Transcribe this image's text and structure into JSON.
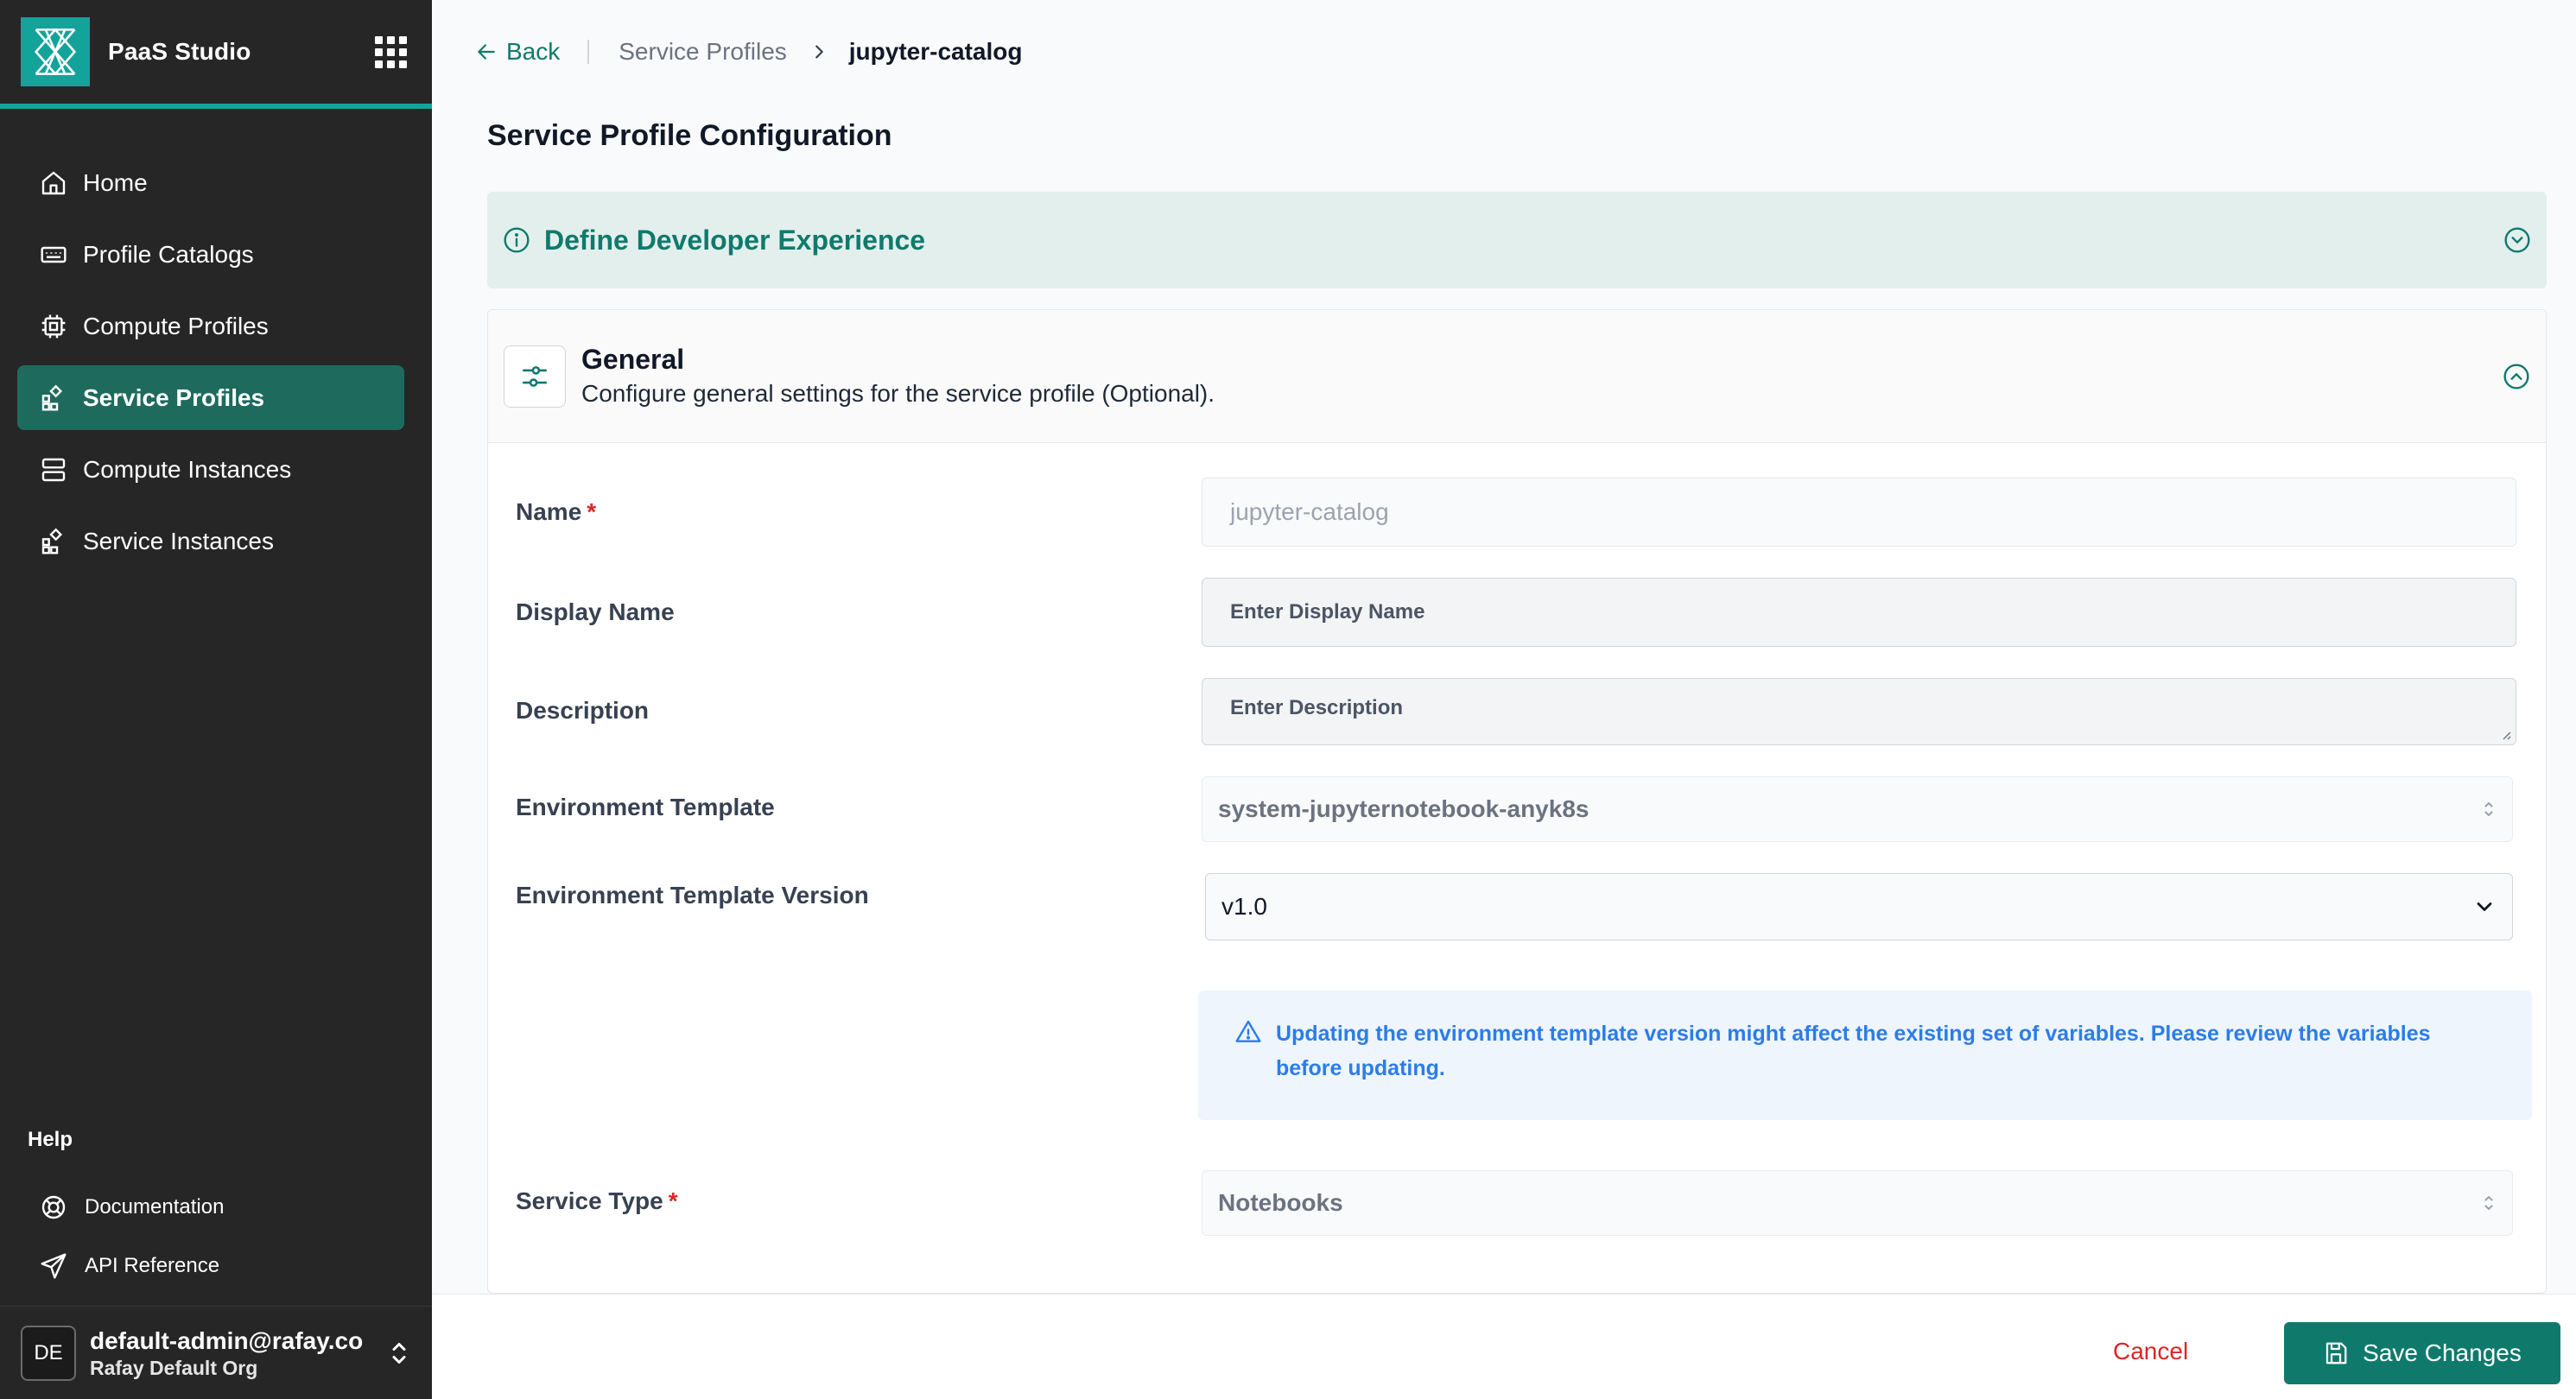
{
  "app": {
    "name": "PaaS Studio",
    "brand_color": "#14a39a"
  },
  "sidebar": {
    "items": [
      {
        "label": "Home",
        "icon": "home-icon",
        "active": false
      },
      {
        "label": "Profile Catalogs",
        "icon": "catalog-icon",
        "active": false
      },
      {
        "label": "Compute Profiles",
        "icon": "chip-icon",
        "active": false
      },
      {
        "label": "Service Profiles",
        "icon": "widgets-icon",
        "active": true
      },
      {
        "label": "Compute Instances",
        "icon": "server-icon",
        "active": false
      },
      {
        "label": "Service Instances",
        "icon": "widgets-icon",
        "active": false
      }
    ],
    "help": {
      "title": "Help",
      "items": [
        {
          "label": "Documentation",
          "icon": "lifebuoy-icon"
        },
        {
          "label": "API Reference",
          "icon": "send-icon"
        }
      ]
    },
    "user": {
      "initials": "DE",
      "email": "default-admin@rafay.co",
      "org": "Rafay Default Org"
    }
  },
  "breadcrumb": {
    "back": "Back",
    "parent": "Service Profiles",
    "current": "jupyter-catalog"
  },
  "page": {
    "title": "Service Profile Configuration"
  },
  "dev_experience": {
    "label": "Define Developer Experience"
  },
  "general": {
    "title": "General",
    "subtitle": "Configure general settings for the service profile (Optional).",
    "fields": {
      "name": {
        "label": "Name",
        "required": "*",
        "value": "jupyter-catalog"
      },
      "display_name": {
        "label": "Display Name",
        "placeholder": "Enter Display Name"
      },
      "description": {
        "label": "Description",
        "placeholder": "Enter Description"
      },
      "env_template": {
        "label": "Environment Template",
        "value": "system-jupyternotebook-anyk8s"
      },
      "env_template_version": {
        "label": "Environment Template Version",
        "value": "v1.0"
      },
      "service_type": {
        "label": "Service Type",
        "required": "*",
        "value": "Notebooks"
      }
    },
    "alert": "Updating the environment template version might affect the existing set of variables. Please review the variables before updating."
  },
  "footer": {
    "cancel": "Cancel",
    "save": "Save Changes"
  },
  "colors": {
    "accent": "#0f7a6c",
    "active_nav": "#1e6b5e",
    "danger": "#dc2626",
    "info": "#2b7de9"
  }
}
